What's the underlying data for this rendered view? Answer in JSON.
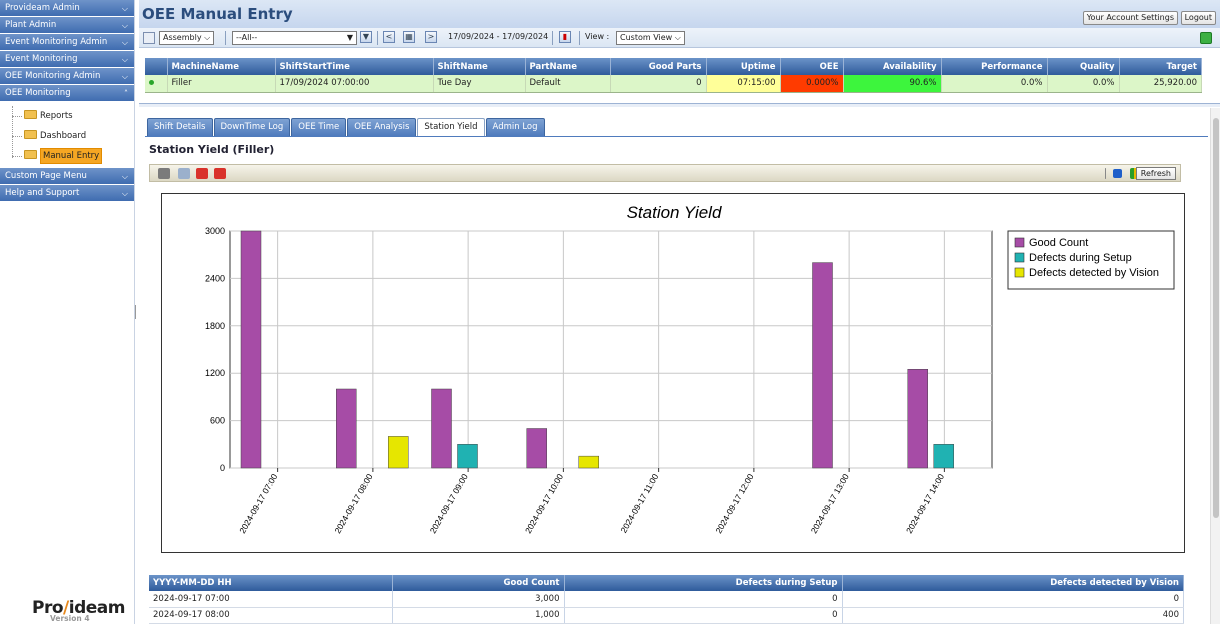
{
  "sidebar": {
    "menus_top": [
      "Provideam Admin",
      "Plant Admin",
      "Event Monitoring Admin",
      "Event Monitoring",
      "OEE Monitoring Admin",
      "OEE Monitoring"
    ],
    "tree": [
      "Reports",
      "Dashboard",
      "Manual Entry"
    ],
    "menus_bottom": [
      "Custom Page Menu",
      "Help and Support"
    ],
    "logo_left": "Pro",
    "logo_right": "ideam",
    "version": "Version 4"
  },
  "header": {
    "title": "OEE Manual Entry",
    "account_settings": "Your Account Settings",
    "logout": "Logout"
  },
  "toolbar": {
    "scope_select": "Assembly",
    "filter_select": "--All--",
    "prev": "<",
    "next": ">",
    "date_range": "17/09/2024 - 17/09/2024",
    "view_label": "View :",
    "view_select": "Custom View"
  },
  "machine_table": {
    "headers": [
      "MachineName",
      "ShiftStartTime",
      "ShiftName",
      "PartName",
      "Good Parts",
      "Uptime",
      "OEE",
      "Availability",
      "Performance",
      "Quality",
      "Target"
    ],
    "row": [
      "Filler",
      "17/09/2024 07:00:00",
      "Tue Day",
      "Default",
      "0",
      "07:15:00",
      "0.000%",
      "90.6%",
      "0.0%",
      "0.0%",
      "25,920.00"
    ]
  },
  "tabs": [
    "Shift Details",
    "DownTime Log",
    "OEE Time",
    "OEE Analysis",
    "Station Yield",
    "Admin Log"
  ],
  "section_title": "Station Yield (Filler)",
  "refresh_label": "Refresh",
  "colors": {
    "good": "#a64ca6",
    "setup": "#20b2b2",
    "vision": "#e6e600",
    "oee_bad": "#ff3b00",
    "avail_good": "#3df53d",
    "uptime": "#ffff99"
  },
  "chart_data": {
    "type": "bar",
    "title": "Station Yield",
    "categories": [
      "2024-09-17 07:00",
      "2024-09-17 08:00",
      "2024-09-17 09:00",
      "2024-09-17 10:00",
      "2024-09-17 11:00",
      "2024-09-17 12:00",
      "2024-09-17 13:00",
      "2024-09-17 14:00"
    ],
    "series": [
      {
        "name": "Good Count",
        "values": [
          3000,
          1000,
          1000,
          500,
          0,
          0,
          2600,
          1250
        ]
      },
      {
        "name": "Defects during Setup",
        "values": [
          0,
          0,
          300,
          0,
          0,
          0,
          0,
          300
        ]
      },
      {
        "name": "Defects detected by Vision",
        "values": [
          0,
          400,
          0,
          150,
          0,
          0,
          0,
          0
        ]
      }
    ],
    "ylim": [
      0,
      3000
    ],
    "yticks": [
      "0",
      "600",
      "1200",
      "1800",
      "2400",
      "3000"
    ],
    "grid": true,
    "legend": "top-right"
  },
  "bottom_table": {
    "headers": [
      "YYYY-MM-DD HH",
      "Good Count",
      "Defects during Setup",
      "Defects detected by Vision"
    ],
    "rows": [
      [
        "2024-09-17 07:00",
        "3,000",
        "0",
        "0"
      ],
      [
        "2024-09-17 08:00",
        "1,000",
        "0",
        "400"
      ]
    ]
  }
}
